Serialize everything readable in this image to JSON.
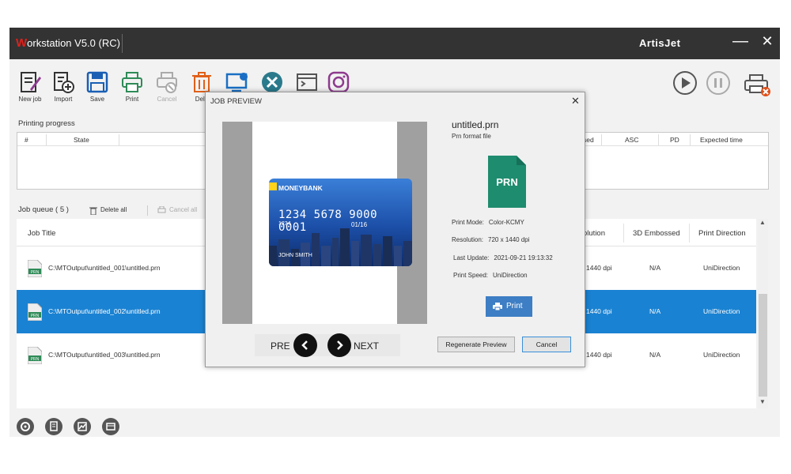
{
  "window": {
    "title_first": "W",
    "title_rest": "orkstation V5.0 (RC)",
    "brand": "ArtisJet",
    "minimize": "—",
    "close": "✕"
  },
  "toolbar": {
    "items": [
      {
        "label": "New job",
        "icon": "new-job-icon"
      },
      {
        "label": "Import",
        "icon": "import-icon"
      },
      {
        "label": "Save",
        "icon": "save-icon"
      },
      {
        "label": "Print",
        "icon": "print-icon"
      },
      {
        "label": "Cancel",
        "icon": "cancel-icon",
        "disabled": true
      },
      {
        "label": "Dele",
        "icon": "delete-icon"
      }
    ],
    "colors": {
      "new_job": "#8e3a8e",
      "save": "#1a5fb4",
      "print": "#2e8b57",
      "delete": "#e0601a",
      "tool_blue": "#1a6fc4",
      "instagram": "#8e3a8e"
    }
  },
  "progress": {
    "label": "Printing progress",
    "columns": [
      "#",
      "State",
      "sed",
      "ASC",
      "PD",
      "Expected time"
    ]
  },
  "queue": {
    "label": "Job queue ( 5 )",
    "delete_all": "Delete all",
    "cancel_all": "Cancel all",
    "columns": [
      "Job Title",
      "olution",
      "3D Embossed",
      "Print Direction"
    ],
    "rows": [
      {
        "path": "C:\\MTOutput\\untitled_001\\untitled.prn",
        "resolution": "1440 dpi",
        "embossed": "N/A",
        "direction": "UniDirection",
        "selected": false
      },
      {
        "path": "C:\\MTOutput\\untitled_002\\untitled.prn",
        "resolution": "1440 dpi",
        "embossed": "N/A",
        "direction": "UniDirection",
        "selected": true
      },
      {
        "path": "C:\\MTOutput\\untitled_003\\untitled.prn",
        "resolution": "1440 dpi",
        "embossed": "N/A",
        "direction": "UniDirection",
        "selected": false
      }
    ],
    "file_badge": "PRN"
  },
  "dialog": {
    "title": "JOB PREVIEW",
    "close": "✕",
    "file_name": "untitled.prn",
    "file_type": "Prn format file",
    "prn_badge": "PRN",
    "print_mode_label": "Print Mode:",
    "print_mode": "Color-KCMY",
    "resolution_label": "Resolution:",
    "resolution": "720 x 1440 dpi",
    "last_update_label": "Last Update:",
    "last_update": "2021-09-21 19:13:32",
    "print_speed_label": "Print Speed:",
    "print_speed": "UniDirection",
    "print_button": "Print",
    "prev_label": "PRE",
    "next_label": "NEXT",
    "regenerate_button": "Regenerate Preview",
    "cancel_button": "Cancel",
    "card": {
      "bank": "MONEYBANK",
      "number": "1234 5678 9000 0001",
      "small": "1234",
      "expiry": "01/16",
      "holder": "JOHN SMITH"
    },
    "prn_color": "#1e8c6e"
  }
}
